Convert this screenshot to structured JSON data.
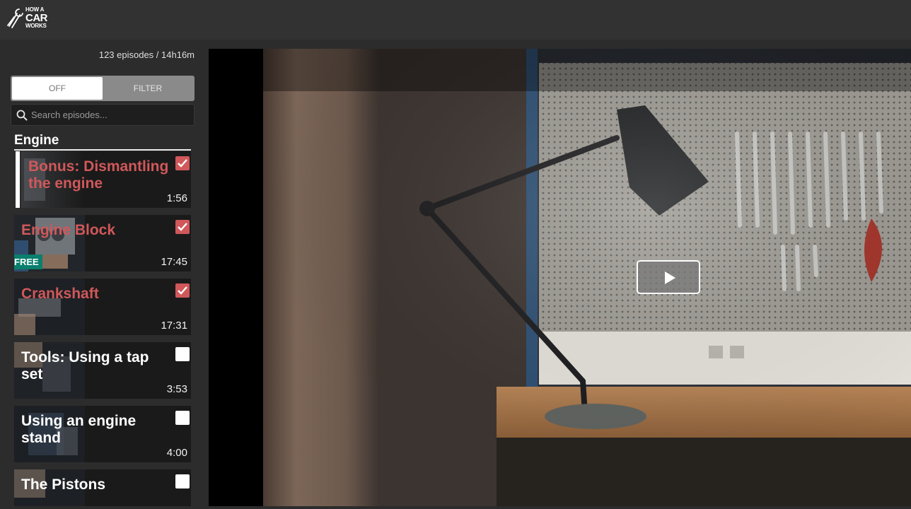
{
  "brand": {
    "logo_line1": "HOW A",
    "logo_line2": "CAR",
    "logo_line3": "WORKS",
    "logo_icon": "wrench-icon"
  },
  "sidebar": {
    "meta": "123 episodes / 14h16m",
    "toggle": {
      "off_label": "OFF",
      "filter_label": "FILTER"
    },
    "search": {
      "placeholder": "Search episodes...",
      "value": ""
    },
    "section_title": "Engine",
    "episodes": [
      {
        "title": "Bonus: Dismantling the engine",
        "duration": "1:56",
        "watched": true,
        "free": false,
        "active": true
      },
      {
        "title": "Engine Block",
        "duration": "17:45",
        "watched": true,
        "free": true,
        "free_label": "FREE",
        "active": false
      },
      {
        "title": "Crankshaft",
        "duration": "17:31",
        "watched": true,
        "free": false,
        "active": false
      },
      {
        "title": "Tools: Using a tap set",
        "duration": "3:53",
        "watched": false,
        "free": false,
        "active": false
      },
      {
        "title": "Using an engine stand",
        "duration": "4:00",
        "watched": false,
        "free": false,
        "active": false
      },
      {
        "title": "The Pistons",
        "duration": "",
        "watched": false,
        "free": false,
        "active": false
      }
    ]
  },
  "player": {
    "play_icon": "play-icon"
  },
  "colors": {
    "watched": "#d0585a",
    "free_badge": "#0a7f6d",
    "background": "#2c2c2c",
    "topbar": "#323232"
  }
}
